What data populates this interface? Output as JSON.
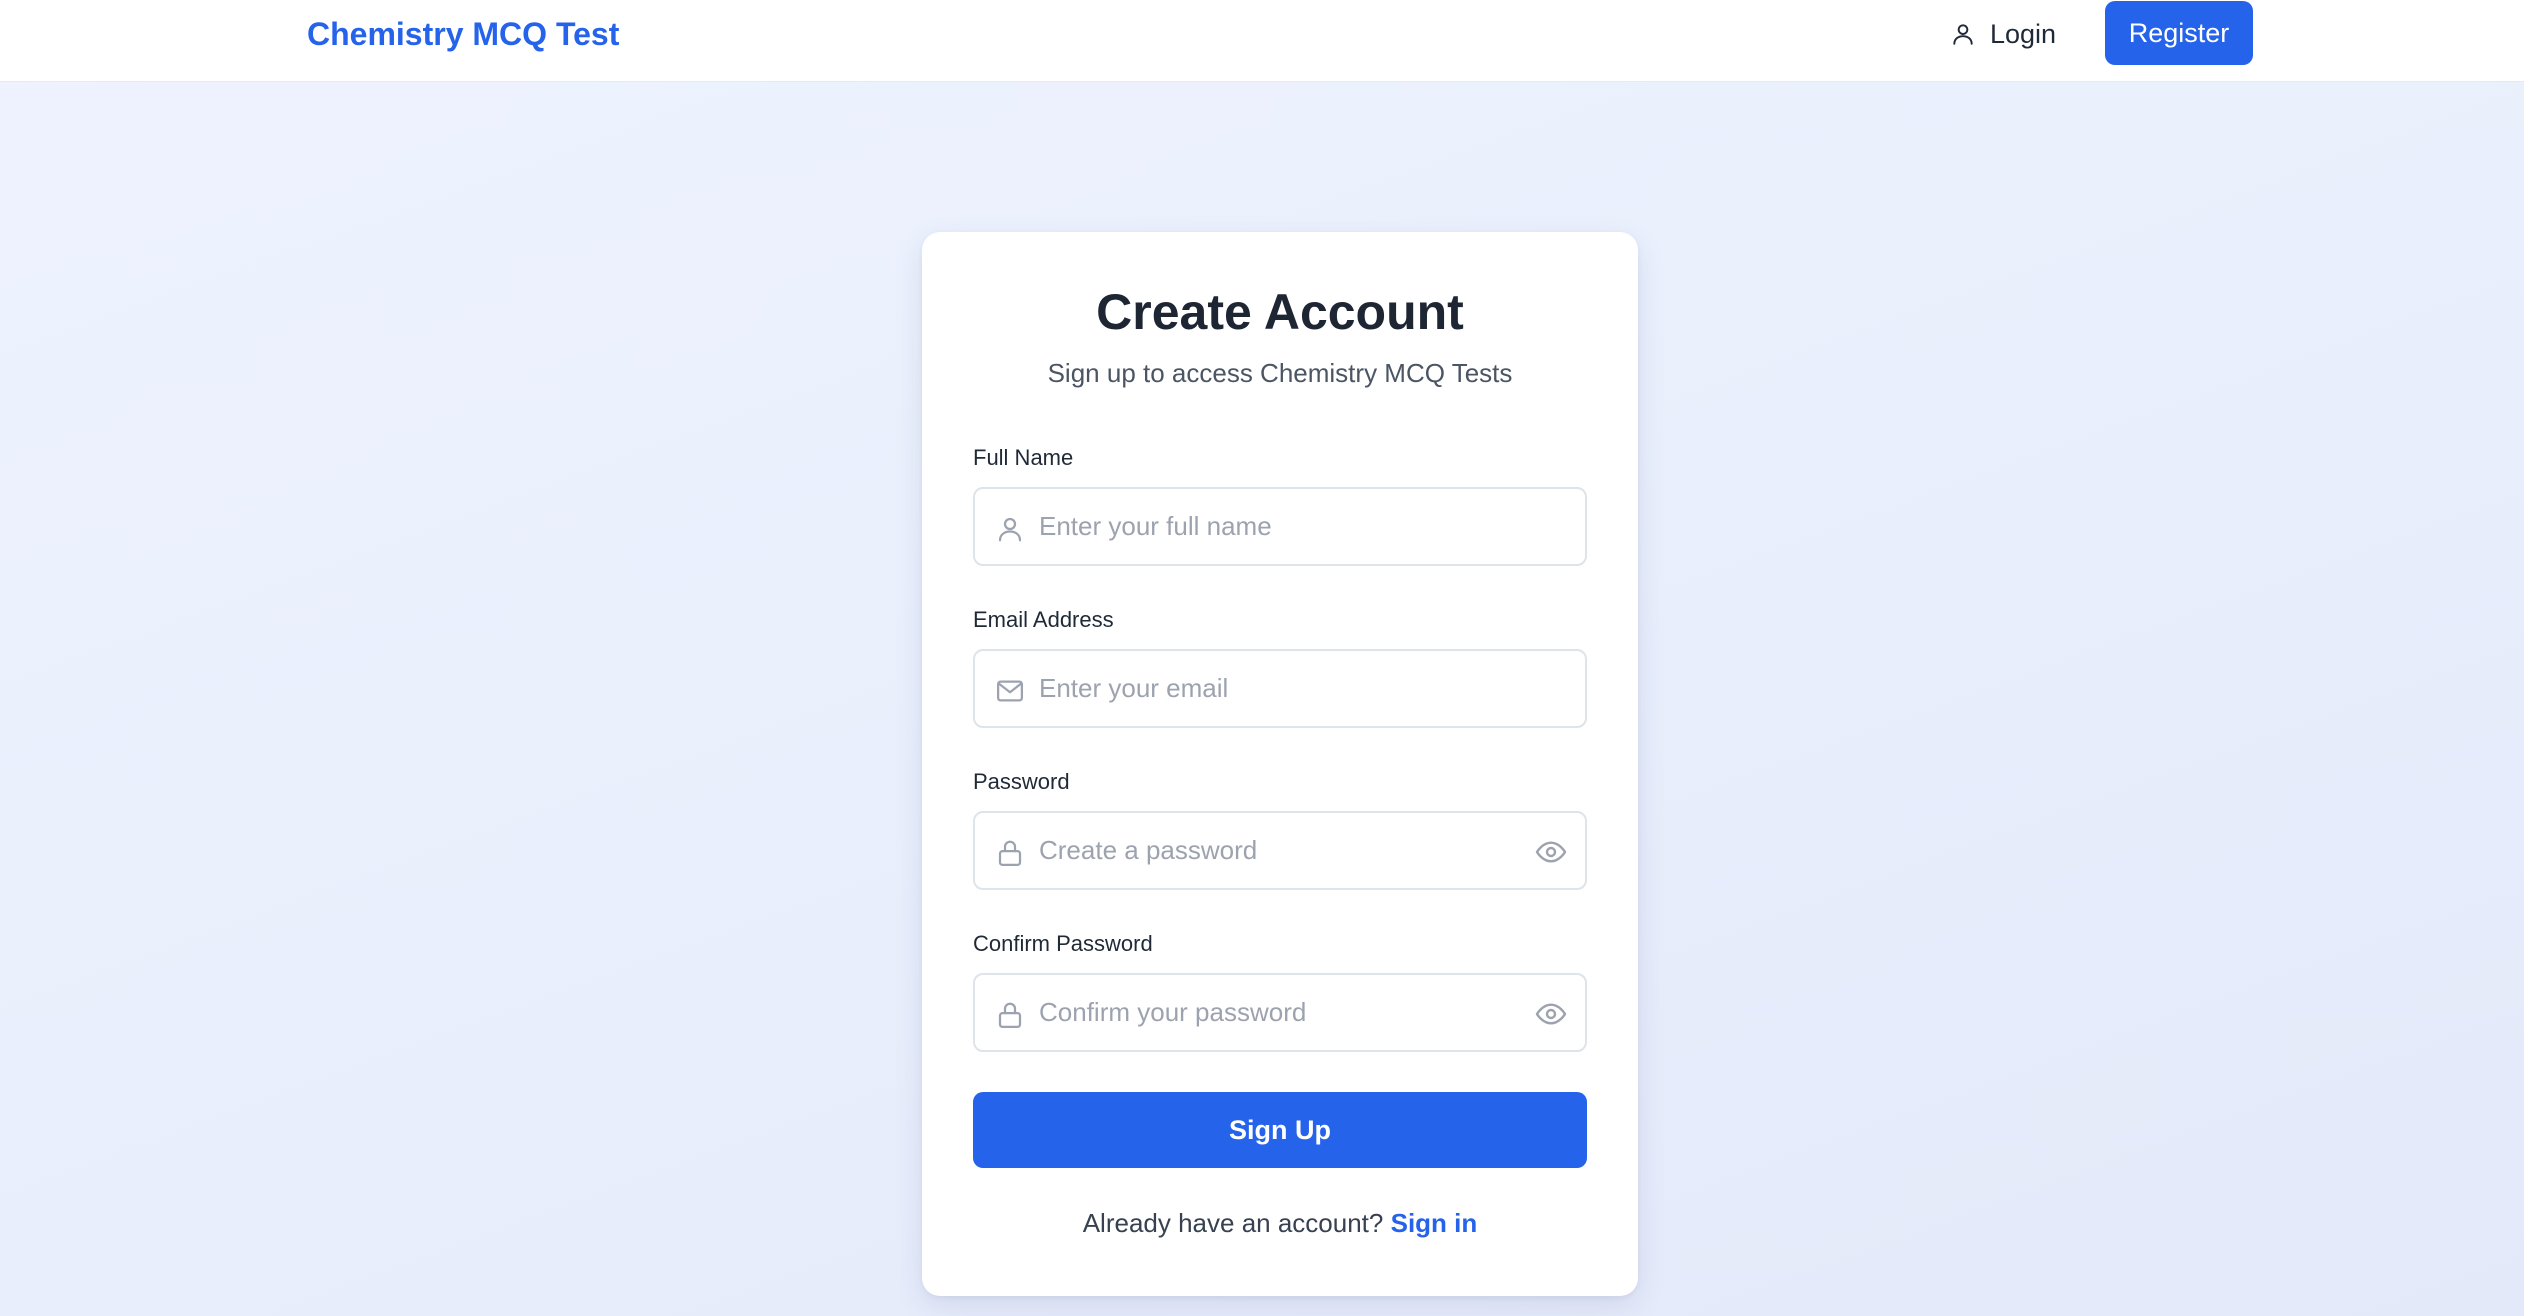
{
  "header": {
    "brand": "Chemistry MCQ Test",
    "login_label": "Login",
    "register_label": "Register"
  },
  "form": {
    "title": "Create Account",
    "subtitle": "Sign up to access Chemistry MCQ Tests",
    "full_name": {
      "label": "Full Name",
      "placeholder": "Enter your full name",
      "value": ""
    },
    "email": {
      "label": "Email Address",
      "placeholder": "Enter your email",
      "value": ""
    },
    "password": {
      "label": "Password",
      "placeholder": "Create a password",
      "value": ""
    },
    "confirm_password": {
      "label": "Confirm Password",
      "placeholder": "Confirm your password",
      "value": ""
    },
    "submit_label": "Sign Up",
    "footer_text": "Already have an account?",
    "footer_link": "Sign in"
  },
  "icons": {
    "nav_login": "user-icon",
    "full_name": "user-icon",
    "email": "mail-icon",
    "password": "lock-icon",
    "confirm_password": "lock-icon",
    "password_toggle": "eye-icon"
  },
  "colors": {
    "accent": "#2563eb",
    "background": "#e9effc",
    "card": "#ffffff"
  }
}
